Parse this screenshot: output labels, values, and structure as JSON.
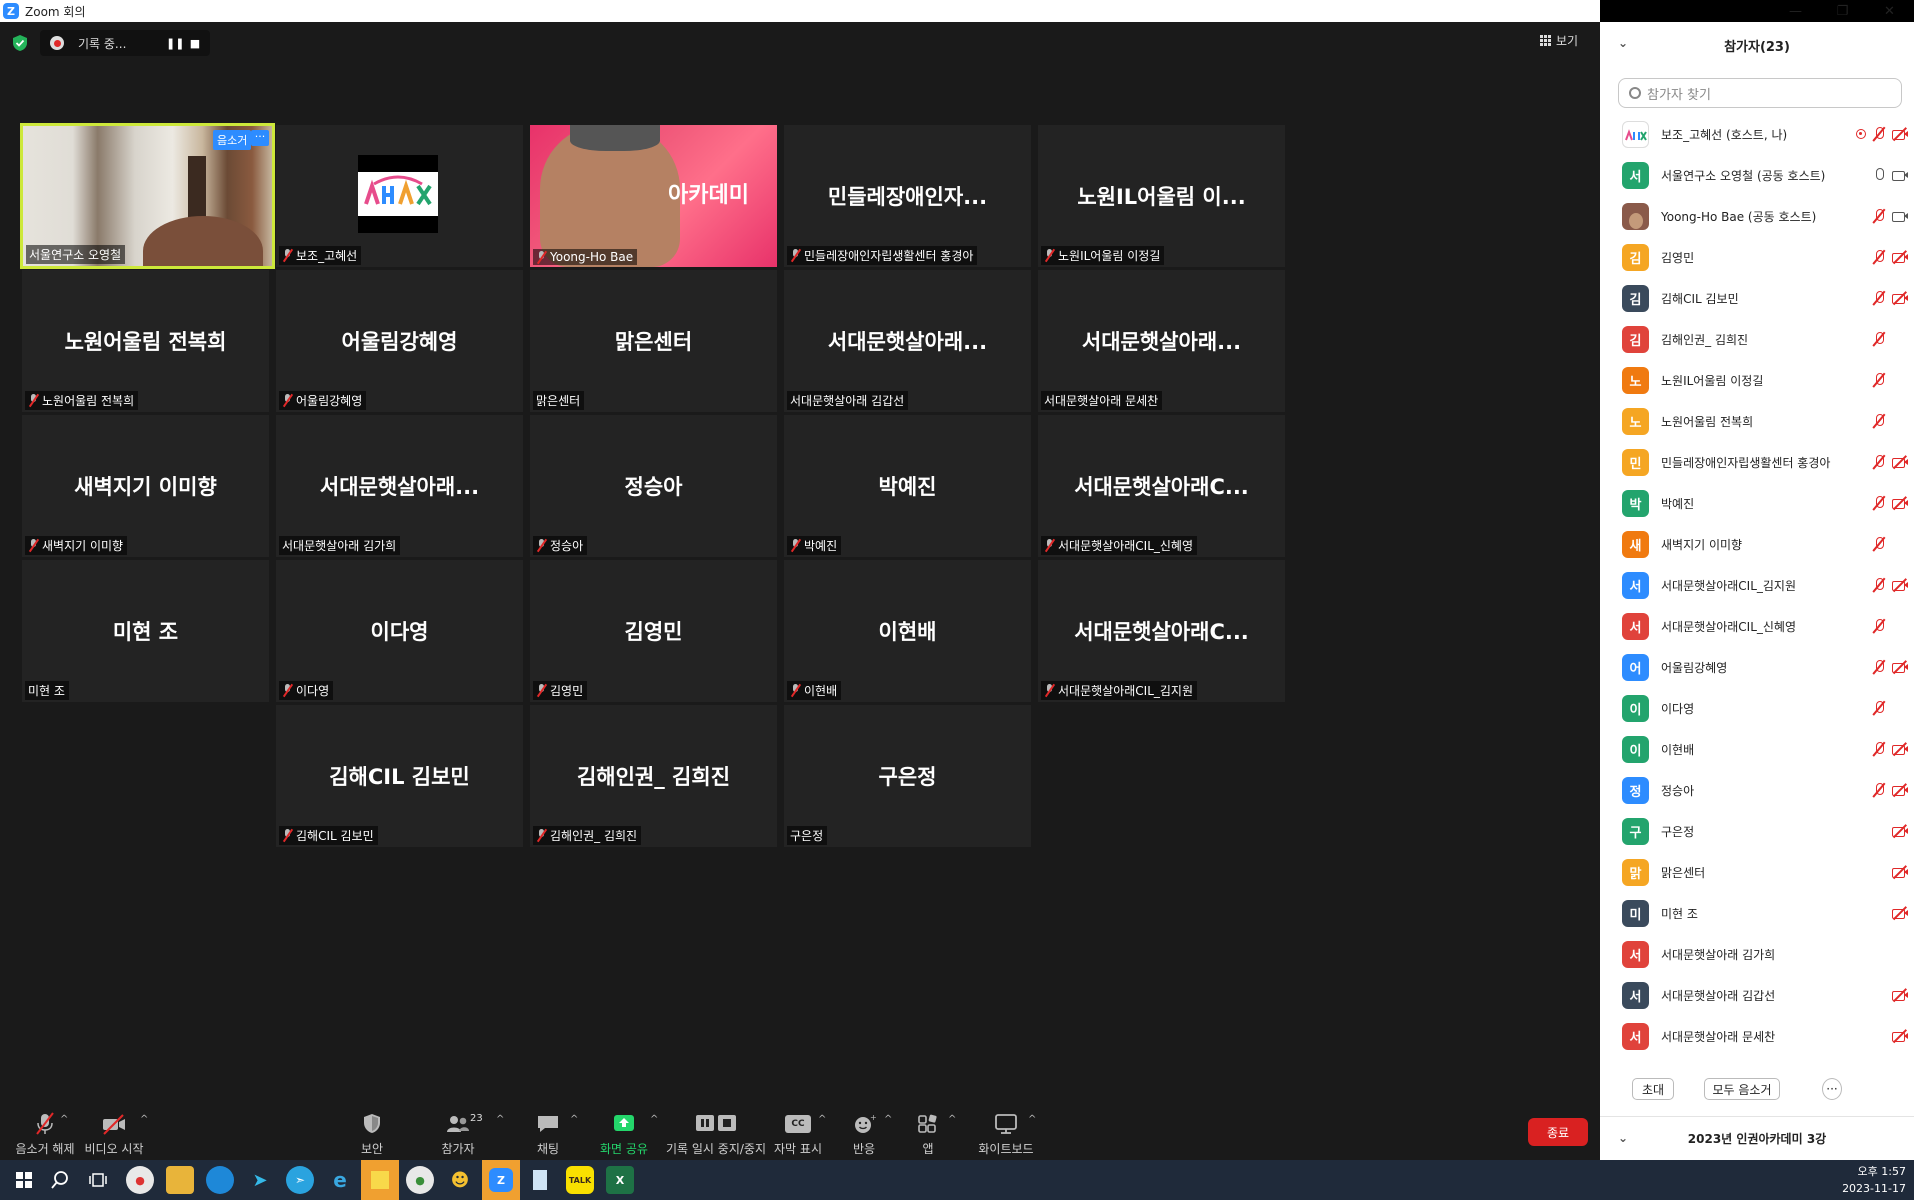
{
  "window": {
    "title": "Zoom 회의",
    "minimize": "—",
    "restore": "❐",
    "close": "✕"
  },
  "topbar": {
    "recording_label": "기록 중...",
    "pause": "❚❚",
    "stop": "■",
    "view_label": "보기"
  },
  "grid": {
    "tiles": [
      {
        "big": "",
        "name": "서울연구소 오영철",
        "muted": false,
        "kind": "video-person",
        "active": true,
        "badge": "음소거",
        "more": "···"
      },
      {
        "big": "",
        "name": "보조_고혜선",
        "muted": true,
        "kind": "logo"
      },
      {
        "big": "아카데미",
        "name": "Yoong-Ho Bae",
        "muted": true,
        "kind": "video-pink"
      },
      {
        "big": "민들레장애인자...",
        "name": "민들레장애인자립생활센터 홍경아",
        "muted": true
      },
      {
        "big": "노원IL어울림 이...",
        "name": "노원IL어울림 이정길",
        "muted": true
      },
      {
        "big": "노원어울림 전복희",
        "name": "노원어울림 전복희",
        "muted": true
      },
      {
        "big": "어울림강혜영",
        "name": "어울림강혜영",
        "muted": true
      },
      {
        "big": "맑은센터",
        "name": "맑은센터",
        "muted": false
      },
      {
        "big": "서대문햇살아래...",
        "name": "서대문햇살아래 김갑선",
        "muted": false
      },
      {
        "big": "서대문햇살아래...",
        "name": "서대문햇살아래 문세찬",
        "muted": false
      },
      {
        "big": "새벽지기 이미향",
        "name": "새벽지기 이미향",
        "muted": true
      },
      {
        "big": "서대문햇살아래...",
        "name": "서대문햇살아래 김가희",
        "muted": false
      },
      {
        "big": "정승아",
        "name": "정승아",
        "muted": true
      },
      {
        "big": "박예진",
        "name": "박예진",
        "muted": true
      },
      {
        "big": "서대문햇살아래C...",
        "name": "서대문햇살아래CIL_신혜영",
        "muted": true
      },
      {
        "big": "미현 조",
        "name": "미현 조",
        "muted": false
      },
      {
        "big": "이다영",
        "name": "이다영",
        "muted": true
      },
      {
        "big": "김영민",
        "name": "김영민",
        "muted": true
      },
      {
        "big": "이현배",
        "name": "이현배",
        "muted": true
      },
      {
        "big": "서대문햇살아래C...",
        "name": "서대문햇살아래CIL_김지원",
        "muted": true
      },
      {
        "big": "김해CIL 김보민",
        "name": "김해CIL 김보민",
        "muted": true
      },
      {
        "big": "김해인권_ 김희진",
        "name": "김해인권_ 김희진",
        "muted": true
      },
      {
        "big": "구은정",
        "name": "구은정",
        "muted": false
      }
    ]
  },
  "toolbar": {
    "unmute": "음소거 해제",
    "start_video": "비디오 시작",
    "security": "보안",
    "participants": "참가자",
    "participants_count": "23",
    "chat": "채팅",
    "share": "화면 공유",
    "record_pause": "기록 일시 중지/중지",
    "captions": "자막 표시",
    "cc": "CC",
    "reactions": "반응",
    "apps": "앱",
    "whiteboard": "화이트보드",
    "end": "종료"
  },
  "panel": {
    "title": "참가자(23)",
    "search_placeholder": "참가자 찾기",
    "participants": [
      {
        "initial": "",
        "name": "보조_고혜선 (호스트, 나)",
        "color": "#ffffff",
        "logo": true,
        "rec": true,
        "mic": "off",
        "cam": "off"
      },
      {
        "initial": "서",
        "name": "서울연구소 오영철 (공동 호스트)",
        "color": "#23a46d",
        "mic": "on",
        "cam": "on"
      },
      {
        "initial": "",
        "name": "Yoong-Ho Bae (공동 호스트)",
        "color": "#8a5a4a",
        "photo": true,
        "mic": "off",
        "cam": "on"
      },
      {
        "initial": "김",
        "name": "김영민",
        "color": "#f5a623",
        "mic": "off",
        "cam": "off"
      },
      {
        "initial": "김",
        "name": "김해CIL 김보민",
        "color": "#3a4a5c",
        "mic": "off",
        "cam": "off"
      },
      {
        "initial": "김",
        "name": "김해인권_ 김희진",
        "color": "#e0433b",
        "mic": "off",
        "cam": ""
      },
      {
        "initial": "노",
        "name": "노원IL어울림 이정길",
        "color": "#f07a10",
        "mic": "off",
        "cam": ""
      },
      {
        "initial": "노",
        "name": "노원어울림 전복희",
        "color": "#f5a623",
        "mic": "off",
        "cam": ""
      },
      {
        "initial": "민",
        "name": "민들레장애인자립생활센터 홍경아",
        "color": "#f5a623",
        "mic": "off",
        "cam": "off"
      },
      {
        "initial": "박",
        "name": "박예진",
        "color": "#23a46d",
        "mic": "off",
        "cam": "off"
      },
      {
        "initial": "새",
        "name": "새벽지기 이미향",
        "color": "#f07a10",
        "mic": "off",
        "cam": ""
      },
      {
        "initial": "서",
        "name": "서대문햇살아래CIL_김지원",
        "color": "#2d8cff",
        "mic": "off",
        "cam": "off"
      },
      {
        "initial": "서",
        "name": "서대문햇살아래CIL_신혜영",
        "color": "#e0433b",
        "mic": "off",
        "cam": ""
      },
      {
        "initial": "어",
        "name": "어울림강혜영",
        "color": "#2d8cff",
        "mic": "off",
        "cam": "off"
      },
      {
        "initial": "이",
        "name": "이다영",
        "color": "#23a46d",
        "mic": "off",
        "cam": ""
      },
      {
        "initial": "이",
        "name": "이현배",
        "color": "#23a46d",
        "mic": "off",
        "cam": "off"
      },
      {
        "initial": "정",
        "name": "정승아",
        "color": "#2d8cff",
        "mic": "off",
        "cam": "off"
      },
      {
        "initial": "구",
        "name": "구은정",
        "color": "#23a46d",
        "mic": "",
        "cam": "off"
      },
      {
        "initial": "맑",
        "name": "맑은센터",
        "color": "#f5a623",
        "mic": "",
        "cam": "off"
      },
      {
        "initial": "미",
        "name": "미현 조",
        "color": "#3a4a5c",
        "mic": "",
        "cam": "off"
      },
      {
        "initial": "서",
        "name": "서대문햇살아래 김가희",
        "color": "#e0433b",
        "mic": "",
        "cam": ""
      },
      {
        "initial": "서",
        "name": "서대문햇살아래 김갑선",
        "color": "#3a4a5c",
        "mic": "",
        "cam": "off"
      },
      {
        "initial": "서",
        "name": "서대문햇살아래 문세찬",
        "color": "#e0433b",
        "mic": "",
        "cam": "off"
      }
    ],
    "invite": "초대",
    "mute_all": "모두 음소거",
    "more": "···",
    "bottom_title": "2023년 인권아카데미 3강"
  },
  "taskbar": {
    "time": "오후 1:57",
    "date": "2023-11-17"
  }
}
